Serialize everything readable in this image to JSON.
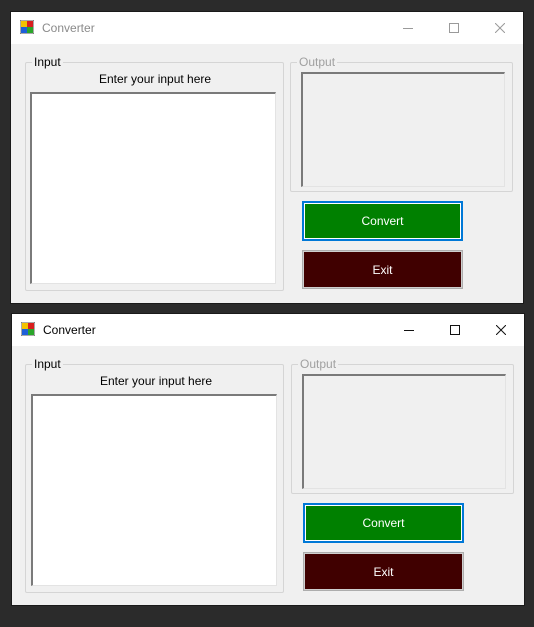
{
  "colors": {
    "convert_button": "#008000",
    "exit_button": "#400000",
    "focus_border": "#0078d7",
    "window_background": "#f0f0f0"
  },
  "windows": [
    {
      "state": "inactive",
      "title": "Converter",
      "input_group_label": "Input",
      "input_hint": "Enter your input here",
      "input_value": "",
      "output_group_label": "Output",
      "output_value": "",
      "convert_label": "Convert",
      "exit_label": "Exit"
    },
    {
      "state": "active",
      "title": "Converter",
      "input_group_label": "Input",
      "input_hint": "Enter your input here",
      "input_value": "",
      "output_group_label": "Output",
      "output_value": "",
      "convert_label": "Convert",
      "exit_label": "Exit"
    }
  ]
}
